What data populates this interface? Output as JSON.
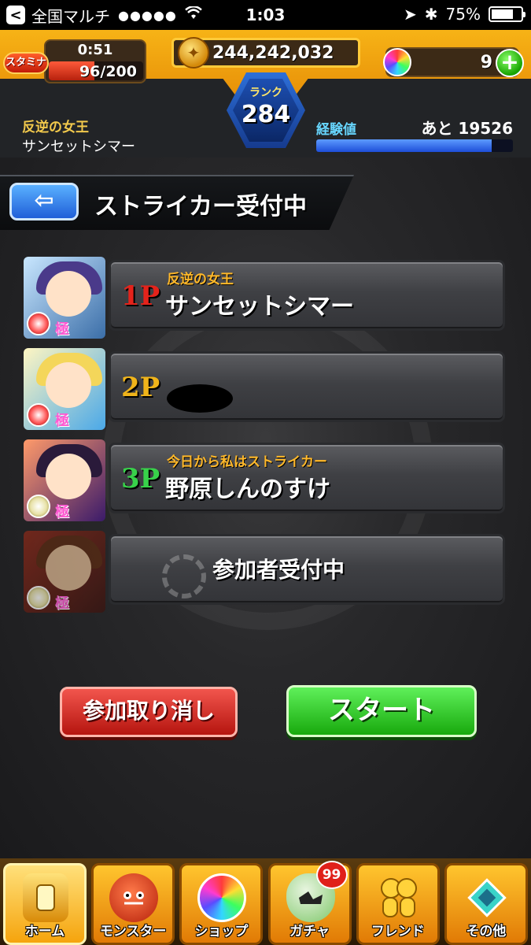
{
  "status_bar": {
    "back_glyph": "<",
    "carrier": "全国マルチ",
    "signal": "●●●●●",
    "wifi": "wifi-icon",
    "time": "1:03",
    "location_glyph": "➤",
    "bluetooth_glyph": "✱",
    "battery_percent_label": "75%",
    "battery_level": 0.75
  },
  "hud": {
    "stamina_tag": "スタミナ",
    "stamina_timer": "0:51",
    "stamina_value": "96/200",
    "stamina_level": 0.48,
    "gold": "244,242,032",
    "orbs": "9",
    "rank_label": "ランク",
    "rank_value": "284",
    "title_sub": "反逆の女王",
    "title_name": "サンセットシマー",
    "exp_label": "経験値",
    "exp_remaining": "あと 19526",
    "exp_level": 0.89
  },
  "screen": {
    "back_arrow": "⇦",
    "title": "ストライカー受付中"
  },
  "slots": [
    {
      "num": "1P",
      "sub": "反逆の女王",
      "name": "サンセットシマー",
      "rank_char": "極"
    },
    {
      "num": "2P",
      "sub": "",
      "name": "",
      "rank_char": "極"
    },
    {
      "num": "3P",
      "sub": "今日から私はストライカー",
      "name": "野原しんのすけ",
      "rank_char": "極"
    },
    {
      "num": "",
      "sub": "",
      "name": "参加者受付中",
      "rank_char": "極"
    }
  ],
  "buttons": {
    "cancel": "参加取り消し",
    "start": "スタート"
  },
  "nav": {
    "items": [
      {
        "label": "ホーム",
        "icon": "home-icon"
      },
      {
        "label": "モンスター",
        "icon": "monster-icon"
      },
      {
        "label": "ショップ",
        "icon": "shop-icon"
      },
      {
        "label": "ガチャ",
        "icon": "gacha-icon",
        "badge": "99"
      },
      {
        "label": "フレンド",
        "icon": "friend-icon"
      },
      {
        "label": "その他",
        "icon": "other-icon"
      }
    ]
  },
  "colors": {
    "num_1p": "#e4231b",
    "num_2p": "#f0b41a",
    "num_3p": "#38d24a"
  }
}
